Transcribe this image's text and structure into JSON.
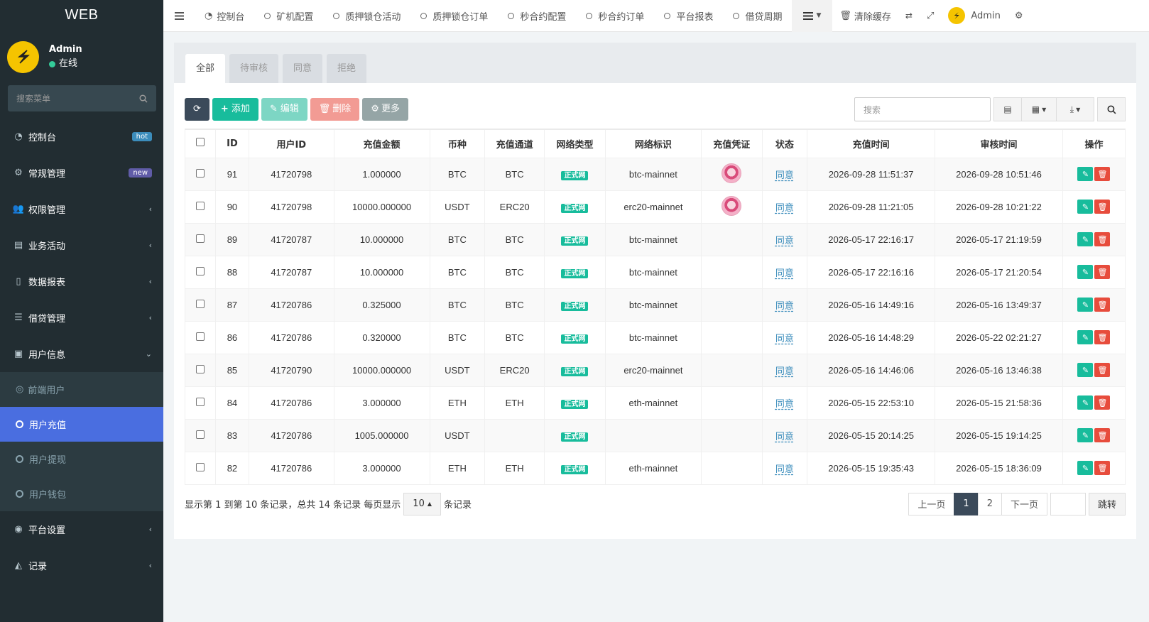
{
  "brand": "WEB",
  "user": {
    "name": "Admin",
    "status": "在线"
  },
  "sidebar_search_placeholder": "搜索菜单",
  "menu": [
    {
      "label": "控制台",
      "icon": "dashboard-icon",
      "badge": "hot",
      "badge_color": "#3c8dbc"
    },
    {
      "label": "常规管理",
      "icon": "cogs-icon",
      "badge": "new",
      "badge_color": "#605ca8"
    },
    {
      "label": "权限管理",
      "icon": "group-icon"
    },
    {
      "label": "业务活动",
      "icon": "list-alt-icon"
    },
    {
      "label": "数据报表",
      "icon": "file-icon"
    },
    {
      "label": "借贷管理",
      "icon": "list-icon"
    },
    {
      "label": "用户信息",
      "icon": "user-icon",
      "expanded": true
    }
  ],
  "submenu": [
    {
      "label": "前端用户",
      "icon": "user-circle-icon"
    },
    {
      "label": "用户充值",
      "active": true
    },
    {
      "label": "用户提现"
    },
    {
      "label": "用户钱包"
    }
  ],
  "menu_after": [
    {
      "label": "平台设置",
      "icon": "dot-circle-icon"
    },
    {
      "label": "记录",
      "icon": "area-chart-icon"
    }
  ],
  "topnav": {
    "items": [
      "控制台",
      "矿机配置",
      "质押锁仓活动",
      "质押锁仓订单",
      "秒合约配置",
      "秒合约订单",
      "平台报表",
      "借贷周期"
    ],
    "clear_cache": "清除缓存",
    "admin": "Admin"
  },
  "tabs": [
    "全部",
    "待审核",
    "同意",
    "拒绝"
  ],
  "toolbar": {
    "add": "添加",
    "edit": "编辑",
    "delete": "删除",
    "more": "更多",
    "search_placeholder": "搜索"
  },
  "table": {
    "headers": [
      "ID",
      "用户ID",
      "充值金额",
      "币种",
      "充值通道",
      "网络类型",
      "网络标识",
      "充值凭证",
      "状态",
      "充值时间",
      "审核时间",
      "操作"
    ],
    "rows": [
      {
        "id": "91",
        "uid": "41720798",
        "amount": "1.000000",
        "coin": "BTC",
        "channel": "BTC",
        "net_type": "正式网",
        "net_id": "btc-mainnet",
        "voucher": true,
        "status": "同意",
        "time": "2026-09-28 11:51:37",
        "audit": "2026-09-28 10:51:46"
      },
      {
        "id": "90",
        "uid": "41720798",
        "amount": "10000.000000",
        "coin": "USDT",
        "channel": "ERC20",
        "net_type": "正式网",
        "net_id": "erc20-mainnet",
        "voucher": true,
        "status": "同意",
        "time": "2026-09-28 11:21:05",
        "audit": "2026-09-28 10:21:22"
      },
      {
        "id": "89",
        "uid": "41720787",
        "amount": "10.000000",
        "coin": "BTC",
        "channel": "BTC",
        "net_type": "正式网",
        "net_id": "btc-mainnet",
        "voucher": false,
        "status": "同意",
        "time": "2026-05-17 22:16:17",
        "audit": "2026-05-17 21:19:59"
      },
      {
        "id": "88",
        "uid": "41720787",
        "amount": "10.000000",
        "coin": "BTC",
        "channel": "BTC",
        "net_type": "正式网",
        "net_id": "btc-mainnet",
        "voucher": false,
        "status": "同意",
        "time": "2026-05-17 22:16:16",
        "audit": "2026-05-17 21:20:54"
      },
      {
        "id": "87",
        "uid": "41720786",
        "amount": "0.325000",
        "coin": "BTC",
        "channel": "BTC",
        "net_type": "正式网",
        "net_id": "btc-mainnet",
        "voucher": false,
        "status": "同意",
        "time": "2026-05-16 14:49:16",
        "audit": "2026-05-16 13:49:37"
      },
      {
        "id": "86",
        "uid": "41720786",
        "amount": "0.320000",
        "coin": "BTC",
        "channel": "BTC",
        "net_type": "正式网",
        "net_id": "btc-mainnet",
        "voucher": false,
        "status": "同意",
        "time": "2026-05-16 14:48:29",
        "audit": "2026-05-22 02:21:27"
      },
      {
        "id": "85",
        "uid": "41720790",
        "amount": "10000.000000",
        "coin": "USDT",
        "channel": "ERC20",
        "net_type": "正式网",
        "net_id": "erc20-mainnet",
        "voucher": false,
        "status": "同意",
        "time": "2026-05-16 14:46:06",
        "audit": "2026-05-16 13:46:38"
      },
      {
        "id": "84",
        "uid": "41720786",
        "amount": "3.000000",
        "coin": "ETH",
        "channel": "ETH",
        "net_type": "正式网",
        "net_id": "eth-mainnet",
        "voucher": false,
        "status": "同意",
        "time": "2026-05-15 22:53:10",
        "audit": "2026-05-15 21:58:36"
      },
      {
        "id": "83",
        "uid": "41720786",
        "amount": "1005.000000",
        "coin": "USDT",
        "channel": "",
        "net_type": "正式网",
        "net_id": "",
        "voucher": false,
        "status": "同意",
        "time": "2026-05-15 20:14:25",
        "audit": "2026-05-15 19:14:25"
      },
      {
        "id": "82",
        "uid": "41720786",
        "amount": "3.000000",
        "coin": "ETH",
        "channel": "ETH",
        "net_type": "正式网",
        "net_id": "eth-mainnet",
        "voucher": false,
        "status": "同意",
        "time": "2026-05-15 19:35:43",
        "audit": "2026-05-15 18:36:09"
      }
    ]
  },
  "footer": {
    "summary": "显示第 1 到第 10 条记录，总共 14 条记录 每页显示",
    "page_size": "10",
    "suffix": "条记录",
    "prev": "上一页",
    "pages": [
      "1",
      "2"
    ],
    "next": "下一页",
    "jump": "跳转"
  }
}
